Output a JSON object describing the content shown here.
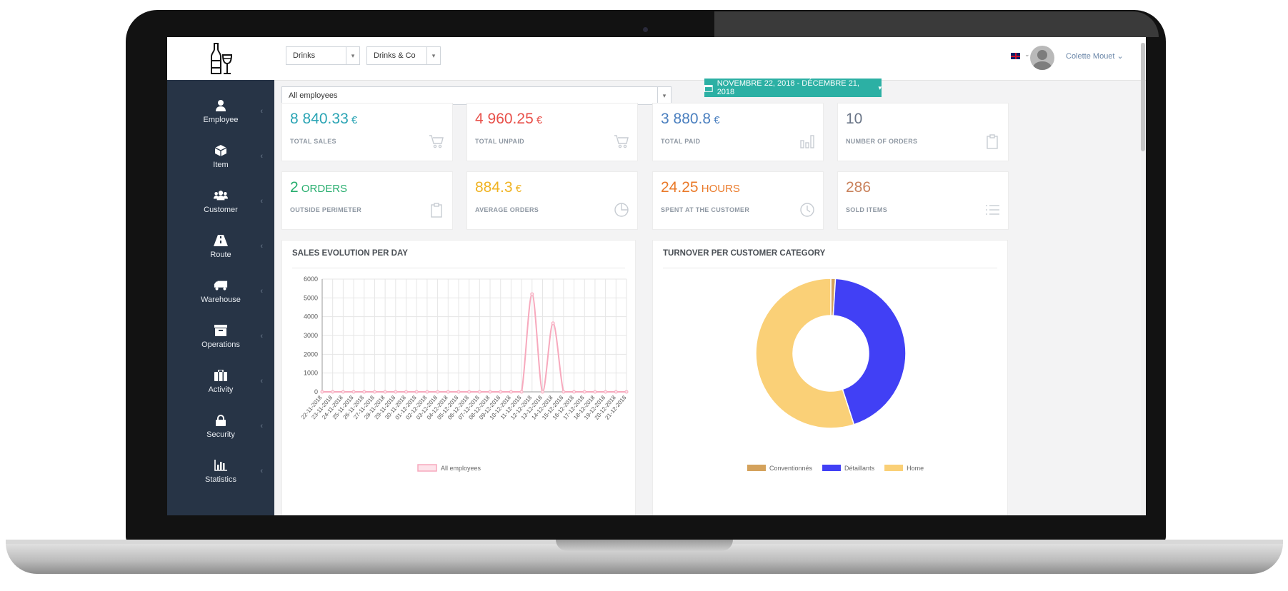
{
  "app": {
    "brand_icon": "bottle-glass-icon",
    "top": {
      "company_select": "Drinks",
      "store_select": "Drinks & Co",
      "language_flag": "uk-flag-icon",
      "user_name": "Colette Mouet"
    },
    "filters": {
      "employee_select": "All employees",
      "date_range": "NOVEMBRE 22, 2018 - DÉCEMBRE 21, 2018"
    }
  },
  "sidebar": {
    "items": [
      {
        "label": "Employee",
        "icon": "user-icon"
      },
      {
        "label": "Item",
        "icon": "cube-icon"
      },
      {
        "label": "Customer",
        "icon": "users-icon"
      },
      {
        "label": "Route",
        "icon": "road-icon"
      },
      {
        "label": "Warehouse",
        "icon": "truck-icon"
      },
      {
        "label": "Operations",
        "icon": "archive-icon"
      },
      {
        "label": "Activity",
        "icon": "briefcase-icon"
      },
      {
        "label": "Security",
        "icon": "lock-icon"
      },
      {
        "label": "Statistics",
        "icon": "bar-chart-icon"
      }
    ]
  },
  "stats": [
    {
      "value": "8 840.33",
      "unit": "€",
      "label": "TOTAL SALES",
      "color": "#2aa4b4",
      "icon": "cart-icon"
    },
    {
      "value": "4 960.25",
      "unit": "€",
      "label": "TOTAL UNPAID",
      "color": "#e8504a",
      "icon": "cart-icon"
    },
    {
      "value": "3 880.8",
      "unit": "€",
      "label": "TOTAL PAID",
      "color": "#4a7fbf",
      "icon": "bar-chart-icon"
    },
    {
      "value": "10",
      "unit": "",
      "label": "NUMBER OF ORDERS",
      "color": "#6a7587",
      "icon": "clipboard-icon"
    },
    {
      "value": "2",
      "unit": "ORDERS",
      "label": "OUTSIDE PERIMETER",
      "color": "#27ae6e",
      "icon": "clipboard-icon"
    },
    {
      "value": "884.3",
      "unit": "€",
      "label": "AVERAGE ORDERS",
      "color": "#f0b322",
      "icon": "pie-icon"
    },
    {
      "value": "24.25",
      "unit": "HOURS",
      "label": "SPENT AT THE CUSTOMER",
      "color": "#ea7a2a",
      "icon": "clock-icon"
    },
    {
      "value": "286",
      "unit": "",
      "label": "SOLD ITEMS",
      "color": "#c9825c",
      "icon": "list-icon"
    }
  ],
  "chart_data": [
    {
      "type": "line",
      "title": "SALES EVOLUTION PER DAY",
      "x": [
        "22-11-2018",
        "23-11-2018",
        "24-11-2018",
        "25-11-2018",
        "26-11-2018",
        "27-11-2018",
        "28-11-2018",
        "29-11-2018",
        "30-11-2018",
        "01-12-2018",
        "02-12-2018",
        "03-12-2018",
        "04-12-2018",
        "05-12-2018",
        "06-12-2018",
        "07-12-2018",
        "08-12-2018",
        "09-12-2018",
        "10-12-2018",
        "11-12-2018",
        "12-12-2018",
        "13-12-2018",
        "14-12-2018",
        "15-12-2018",
        "16-12-2018",
        "17-12-2018",
        "18-12-2018",
        "19-12-2018",
        "20-12-2018",
        "21-12-2018"
      ],
      "series": [
        {
          "name": "All employees",
          "color": "#f7a9bd",
          "values": [
            0,
            0,
            0,
            0,
            0,
            0,
            0,
            0,
            0,
            0,
            0,
            0,
            0,
            0,
            0,
            0,
            0,
            0,
            0,
            0,
            5200,
            0,
            3650,
            0,
            0,
            0,
            0,
            0,
            0,
            0
          ]
        }
      ],
      "ylim": [
        0,
        6000
      ],
      "yticks": [
        0,
        1000,
        2000,
        3000,
        4000,
        5000,
        6000
      ],
      "grid": true,
      "legend": "bottom"
    },
    {
      "type": "pie",
      "title": "TURNOVER PER CUSTOMER CATEGORY",
      "donut": true,
      "slices": [
        {
          "name": "Conventionnés",
          "value": 1,
          "color": "#d4a25c"
        },
        {
          "name": "Détaillants",
          "value": 44,
          "color": "#4140f5"
        },
        {
          "name": "Home",
          "value": 55,
          "color": "#fad077"
        }
      ],
      "legend": "bottom"
    }
  ]
}
